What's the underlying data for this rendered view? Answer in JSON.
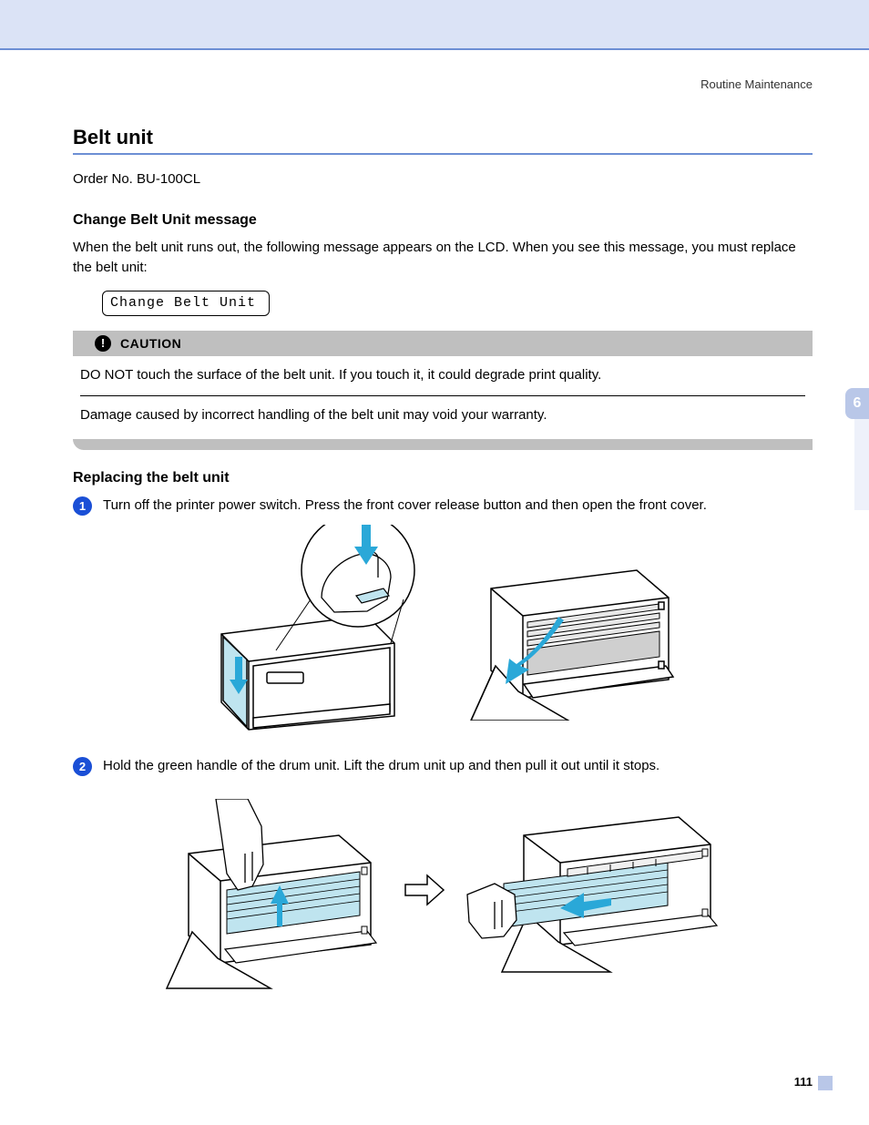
{
  "breadcrumb": "Routine Maintenance",
  "chapter_tab": "6",
  "page_number": "111",
  "title": "Belt unit",
  "order_no": "Order No. BU-100CL",
  "sub1_heading": "Change Belt Unit message",
  "sub1_body": "When the belt unit runs out, the following message appears on the LCD. When you see this message, you must replace the belt unit:",
  "lcd_text": "Change Belt Unit",
  "caution_label": "CAUTION",
  "caution_line1": "DO NOT touch the surface of the belt unit. If you touch it, it could degrade print quality.",
  "caution_line2": "Damage caused by incorrect handling of the belt unit may void your warranty.",
  "sub2_heading": "Replacing the belt unit",
  "steps": [
    {
      "num": "1",
      "text": "Turn off the printer power switch. Press the front cover release button and then open the front cover."
    },
    {
      "num": "2",
      "text": "Hold the green handle of the drum unit. Lift the drum unit up and then pull it out until it stops."
    }
  ]
}
